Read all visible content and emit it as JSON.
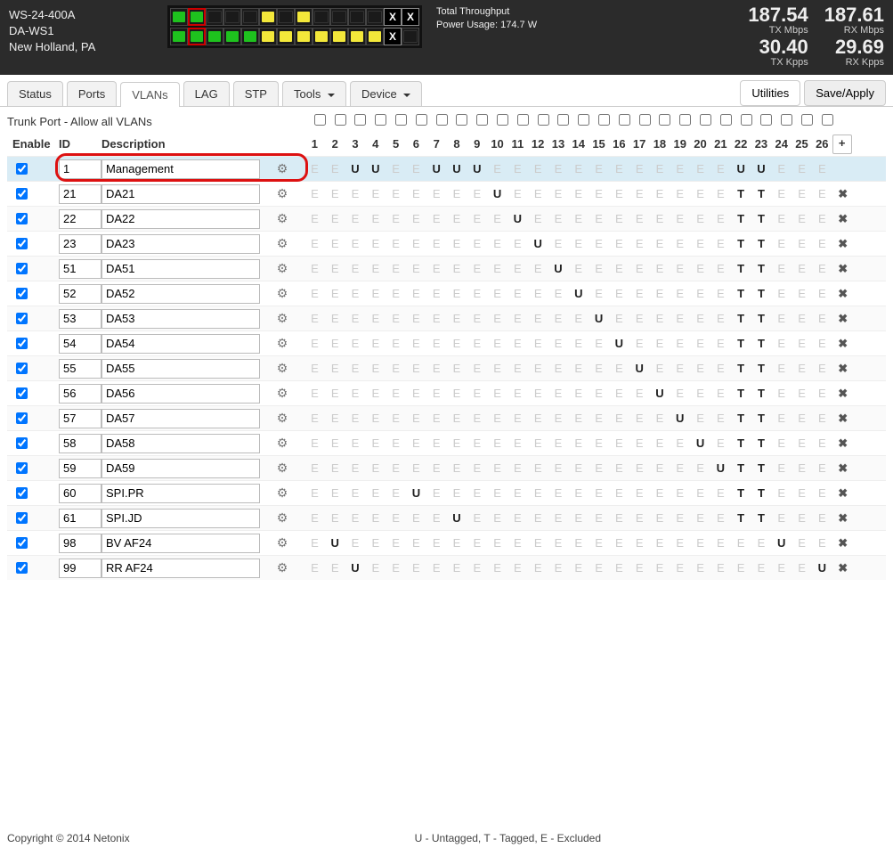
{
  "header": {
    "model": "WS-24-400A",
    "name": "DA-WS1",
    "loc": "New Holland, PA",
    "throughput_label": "Total Throughput",
    "power_label": "Power Usage: 174.7 W",
    "stats": [
      {
        "big": "187.54",
        "sub": "TX Mbps"
      },
      {
        "big": "187.61",
        "sub": "RX Mbps"
      },
      {
        "big": "30.40",
        "sub": "TX Kpps"
      },
      {
        "big": "29.69",
        "sub": "RX Kpps"
      }
    ],
    "ports_top": [
      "green",
      "green",
      "off",
      "off",
      "off",
      "yellow",
      "off",
      "yellow",
      "off",
      "off",
      "off",
      "off",
      "x",
      "x"
    ],
    "ports_bot": [
      "green",
      "green",
      "green",
      "green",
      "green",
      "yellow",
      "yellow",
      "yellow",
      "yellow",
      "yellow",
      "yellow",
      "yellow",
      "x",
      "off"
    ],
    "port_red_top": [
      false,
      true,
      false,
      false,
      false,
      false,
      false,
      false,
      false,
      false,
      false,
      false,
      false,
      false
    ],
    "port_red_bot": [
      false,
      true,
      false,
      false,
      false,
      false,
      false,
      false,
      false,
      false,
      false,
      false,
      false,
      false
    ]
  },
  "tabs": {
    "items": [
      "Status",
      "Ports",
      "VLANs",
      "LAG",
      "STP",
      "Tools",
      "Device"
    ],
    "dropdown": [
      false,
      false,
      false,
      false,
      false,
      true,
      true
    ],
    "active": 2,
    "utilities": "Utilities",
    "save": "Save/Apply"
  },
  "vlan": {
    "trunk_label": "Trunk Port - Allow all VLANs",
    "head_enable": "Enable",
    "head_id": "ID",
    "head_desc": "Description",
    "port_count": 26,
    "add": "+",
    "rows": [
      {
        "en": true,
        "id": "1",
        "desc": "Management",
        "hl": true,
        "del": false,
        "p": [
          "E",
          "E",
          "U",
          "U",
          "E",
          "E",
          "U",
          "U",
          "U",
          "E",
          "E",
          "E",
          "E",
          "E",
          "E",
          "E",
          "E",
          "E",
          "E",
          "E",
          "E",
          "U",
          "U",
          "E",
          "E",
          "E"
        ],
        "b": [
          0,
          0,
          1,
          1,
          0,
          0,
          1,
          1,
          1,
          0,
          0,
          0,
          0,
          0,
          0,
          0,
          0,
          0,
          0,
          0,
          0,
          1,
          1,
          0,
          0,
          0
        ]
      },
      {
        "en": true,
        "id": "21",
        "desc": "DA21",
        "hl": false,
        "del": true,
        "p": [
          "E",
          "E",
          "E",
          "E",
          "E",
          "E",
          "E",
          "E",
          "E",
          "U",
          "E",
          "E",
          "E",
          "E",
          "E",
          "E",
          "E",
          "E",
          "E",
          "E",
          "E",
          "T",
          "T",
          "E",
          "E",
          "E"
        ],
        "b": [
          0,
          0,
          0,
          0,
          0,
          0,
          0,
          0,
          0,
          1,
          0,
          0,
          0,
          0,
          0,
          0,
          0,
          0,
          0,
          0,
          0,
          1,
          1,
          0,
          0,
          0
        ]
      },
      {
        "en": true,
        "id": "22",
        "desc": "DA22",
        "hl": false,
        "del": true,
        "p": [
          "E",
          "E",
          "E",
          "E",
          "E",
          "E",
          "E",
          "E",
          "E",
          "E",
          "U",
          "E",
          "E",
          "E",
          "E",
          "E",
          "E",
          "E",
          "E",
          "E",
          "E",
          "T",
          "T",
          "E",
          "E",
          "E"
        ],
        "b": [
          0,
          0,
          0,
          0,
          0,
          0,
          0,
          0,
          0,
          0,
          1,
          0,
          0,
          0,
          0,
          0,
          0,
          0,
          0,
          0,
          0,
          1,
          1,
          0,
          0,
          0
        ]
      },
      {
        "en": true,
        "id": "23",
        "desc": "DA23",
        "hl": false,
        "del": true,
        "p": [
          "E",
          "E",
          "E",
          "E",
          "E",
          "E",
          "E",
          "E",
          "E",
          "E",
          "E",
          "U",
          "E",
          "E",
          "E",
          "E",
          "E",
          "E",
          "E",
          "E",
          "E",
          "T",
          "T",
          "E",
          "E",
          "E"
        ],
        "b": [
          0,
          0,
          0,
          0,
          0,
          0,
          0,
          0,
          0,
          0,
          0,
          1,
          0,
          0,
          0,
          0,
          0,
          0,
          0,
          0,
          0,
          1,
          1,
          0,
          0,
          0
        ]
      },
      {
        "en": true,
        "id": "51",
        "desc": "DA51",
        "hl": false,
        "del": true,
        "p": [
          "E",
          "E",
          "E",
          "E",
          "E",
          "E",
          "E",
          "E",
          "E",
          "E",
          "E",
          "E",
          "U",
          "E",
          "E",
          "E",
          "E",
          "E",
          "E",
          "E",
          "E",
          "T",
          "T",
          "E",
          "E",
          "E"
        ],
        "b": [
          0,
          0,
          0,
          0,
          0,
          0,
          0,
          0,
          0,
          0,
          0,
          0,
          1,
          0,
          0,
          0,
          0,
          0,
          0,
          0,
          0,
          1,
          1,
          0,
          0,
          0
        ]
      },
      {
        "en": true,
        "id": "52",
        "desc": "DA52",
        "hl": false,
        "del": true,
        "p": [
          "E",
          "E",
          "E",
          "E",
          "E",
          "E",
          "E",
          "E",
          "E",
          "E",
          "E",
          "E",
          "E",
          "U",
          "E",
          "E",
          "E",
          "E",
          "E",
          "E",
          "E",
          "T",
          "T",
          "E",
          "E",
          "E"
        ],
        "b": [
          0,
          0,
          0,
          0,
          0,
          0,
          0,
          0,
          0,
          0,
          0,
          0,
          0,
          1,
          0,
          0,
          0,
          0,
          0,
          0,
          0,
          1,
          1,
          0,
          0,
          0
        ]
      },
      {
        "en": true,
        "id": "53",
        "desc": "DA53",
        "hl": false,
        "del": true,
        "p": [
          "E",
          "E",
          "E",
          "E",
          "E",
          "E",
          "E",
          "E",
          "E",
          "E",
          "E",
          "E",
          "E",
          "E",
          "U",
          "E",
          "E",
          "E",
          "E",
          "E",
          "E",
          "T",
          "T",
          "E",
          "E",
          "E"
        ],
        "b": [
          0,
          0,
          0,
          0,
          0,
          0,
          0,
          0,
          0,
          0,
          0,
          0,
          0,
          0,
          1,
          0,
          0,
          0,
          0,
          0,
          0,
          1,
          1,
          0,
          0,
          0
        ]
      },
      {
        "en": true,
        "id": "54",
        "desc": "DA54",
        "hl": false,
        "del": true,
        "p": [
          "E",
          "E",
          "E",
          "E",
          "E",
          "E",
          "E",
          "E",
          "E",
          "E",
          "E",
          "E",
          "E",
          "E",
          "E",
          "U",
          "E",
          "E",
          "E",
          "E",
          "E",
          "T",
          "T",
          "E",
          "E",
          "E"
        ],
        "b": [
          0,
          0,
          0,
          0,
          0,
          0,
          0,
          0,
          0,
          0,
          0,
          0,
          0,
          0,
          0,
          1,
          0,
          0,
          0,
          0,
          0,
          1,
          1,
          0,
          0,
          0
        ]
      },
      {
        "en": true,
        "id": "55",
        "desc": "DA55",
        "hl": false,
        "del": true,
        "p": [
          "E",
          "E",
          "E",
          "E",
          "E",
          "E",
          "E",
          "E",
          "E",
          "E",
          "E",
          "E",
          "E",
          "E",
          "E",
          "E",
          "U",
          "E",
          "E",
          "E",
          "E",
          "T",
          "T",
          "E",
          "E",
          "E"
        ],
        "b": [
          0,
          0,
          0,
          0,
          0,
          0,
          0,
          0,
          0,
          0,
          0,
          0,
          0,
          0,
          0,
          0,
          1,
          0,
          0,
          0,
          0,
          1,
          1,
          0,
          0,
          0
        ]
      },
      {
        "en": true,
        "id": "56",
        "desc": "DA56",
        "hl": false,
        "del": true,
        "p": [
          "E",
          "E",
          "E",
          "E",
          "E",
          "E",
          "E",
          "E",
          "E",
          "E",
          "E",
          "E",
          "E",
          "E",
          "E",
          "E",
          "E",
          "U",
          "E",
          "E",
          "E",
          "T",
          "T",
          "E",
          "E",
          "E"
        ],
        "b": [
          0,
          0,
          0,
          0,
          0,
          0,
          0,
          0,
          0,
          0,
          0,
          0,
          0,
          0,
          0,
          0,
          0,
          1,
          0,
          0,
          0,
          1,
          1,
          0,
          0,
          0
        ]
      },
      {
        "en": true,
        "id": "57",
        "desc": "DA57",
        "hl": false,
        "del": true,
        "p": [
          "E",
          "E",
          "E",
          "E",
          "E",
          "E",
          "E",
          "E",
          "E",
          "E",
          "E",
          "E",
          "E",
          "E",
          "E",
          "E",
          "E",
          "E",
          "U",
          "E",
          "E",
          "T",
          "T",
          "E",
          "E",
          "E"
        ],
        "b": [
          0,
          0,
          0,
          0,
          0,
          0,
          0,
          0,
          0,
          0,
          0,
          0,
          0,
          0,
          0,
          0,
          0,
          0,
          1,
          0,
          0,
          1,
          1,
          0,
          0,
          0
        ]
      },
      {
        "en": true,
        "id": "58",
        "desc": "DA58",
        "hl": false,
        "del": true,
        "p": [
          "E",
          "E",
          "E",
          "E",
          "E",
          "E",
          "E",
          "E",
          "E",
          "E",
          "E",
          "E",
          "E",
          "E",
          "E",
          "E",
          "E",
          "E",
          "E",
          "U",
          "E",
          "T",
          "T",
          "E",
          "E",
          "E"
        ],
        "b": [
          0,
          0,
          0,
          0,
          0,
          0,
          0,
          0,
          0,
          0,
          0,
          0,
          0,
          0,
          0,
          0,
          0,
          0,
          0,
          1,
          0,
          1,
          1,
          0,
          0,
          0
        ]
      },
      {
        "en": true,
        "id": "59",
        "desc": "DA59",
        "hl": false,
        "del": true,
        "p": [
          "E",
          "E",
          "E",
          "E",
          "E",
          "E",
          "E",
          "E",
          "E",
          "E",
          "E",
          "E",
          "E",
          "E",
          "E",
          "E",
          "E",
          "E",
          "E",
          "E",
          "U",
          "T",
          "T",
          "E",
          "E",
          "E"
        ],
        "b": [
          0,
          0,
          0,
          0,
          0,
          0,
          0,
          0,
          0,
          0,
          0,
          0,
          0,
          0,
          0,
          0,
          0,
          0,
          0,
          0,
          1,
          1,
          1,
          0,
          0,
          0
        ]
      },
      {
        "en": true,
        "id": "60",
        "desc": "SPI.PR",
        "hl": false,
        "del": true,
        "p": [
          "E",
          "E",
          "E",
          "E",
          "E",
          "U",
          "E",
          "E",
          "E",
          "E",
          "E",
          "E",
          "E",
          "E",
          "E",
          "E",
          "E",
          "E",
          "E",
          "E",
          "E",
          "T",
          "T",
          "E",
          "E",
          "E"
        ],
        "b": [
          0,
          0,
          0,
          0,
          0,
          1,
          0,
          0,
          0,
          0,
          0,
          0,
          0,
          0,
          0,
          0,
          0,
          0,
          0,
          0,
          0,
          1,
          1,
          0,
          0,
          0
        ]
      },
      {
        "en": true,
        "id": "61",
        "desc": "SPI.JD",
        "hl": false,
        "del": true,
        "p": [
          "E",
          "E",
          "E",
          "E",
          "E",
          "E",
          "E",
          "U",
          "E",
          "E",
          "E",
          "E",
          "E",
          "E",
          "E",
          "E",
          "E",
          "E",
          "E",
          "E",
          "E",
          "T",
          "T",
          "E",
          "E",
          "E"
        ],
        "b": [
          0,
          0,
          0,
          0,
          0,
          0,
          0,
          1,
          0,
          0,
          0,
          0,
          0,
          0,
          0,
          0,
          0,
          0,
          0,
          0,
          0,
          1,
          1,
          0,
          0,
          0
        ]
      },
      {
        "en": true,
        "id": "98",
        "desc": "BV AF24",
        "hl": false,
        "del": true,
        "p": [
          "E",
          "U",
          "E",
          "E",
          "E",
          "E",
          "E",
          "E",
          "E",
          "E",
          "E",
          "E",
          "E",
          "E",
          "E",
          "E",
          "E",
          "E",
          "E",
          "E",
          "E",
          "E",
          "E",
          "U",
          "E",
          "E"
        ],
        "b": [
          0,
          1,
          0,
          0,
          0,
          0,
          0,
          0,
          0,
          0,
          0,
          0,
          0,
          0,
          0,
          0,
          0,
          0,
          0,
          0,
          0,
          0,
          0,
          1,
          0,
          0
        ]
      },
      {
        "en": true,
        "id": "99",
        "desc": "RR AF24",
        "hl": false,
        "del": true,
        "p": [
          "E",
          "E",
          "U",
          "E",
          "E",
          "E",
          "E",
          "E",
          "E",
          "E",
          "E",
          "E",
          "E",
          "E",
          "E",
          "E",
          "E",
          "E",
          "E",
          "E",
          "E",
          "E",
          "E",
          "E",
          "E",
          "U"
        ],
        "b": [
          0,
          0,
          1,
          0,
          0,
          0,
          0,
          0,
          0,
          0,
          0,
          0,
          0,
          0,
          0,
          0,
          0,
          0,
          0,
          0,
          0,
          0,
          0,
          0,
          0,
          1
        ]
      }
    ]
  },
  "footer": {
    "copy": "Copyright © 2014 Netonix",
    "legend": "U - Untagged, T - Tagged, E - Excluded"
  }
}
